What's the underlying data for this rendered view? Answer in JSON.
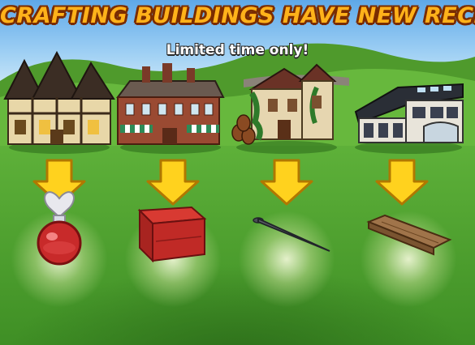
{
  "banner": {
    "title": "CRAFTING BUILDINGS HAVE NEW RECIPES!",
    "subtitle": "Limited time only!"
  },
  "recipes": [
    {
      "building_icon": "tudor-winery-icon",
      "item_icon": "heart-potion-bottle-icon"
    },
    {
      "building_icon": "brick-spa-building-icon",
      "item_icon": "red-brick-icon"
    },
    {
      "building_icon": "ivy-manor-winery-icon",
      "item_icon": "iron-nail-icon"
    },
    {
      "building_icon": "modern-craftshop-building-icon",
      "item_icon": "wooden-plank-icon"
    }
  ],
  "colors": {
    "title": "#ffb21a",
    "title_outline": "#7a2c00",
    "arrow": "#ffd21e",
    "grass": "#5fb23a",
    "sky": "#9fd0f4"
  }
}
